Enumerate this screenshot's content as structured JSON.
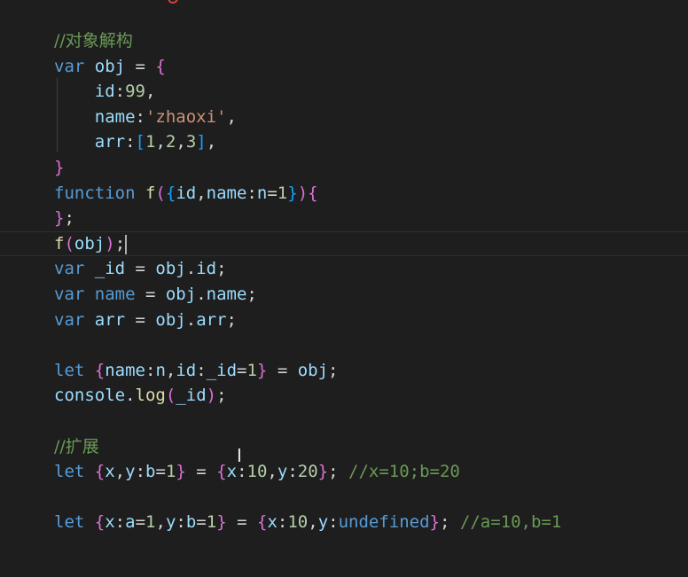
{
  "editor": {
    "colors": {
      "background": "#1e1e1e",
      "comment": "#6a9955",
      "keyword": "#569cd6",
      "identifier": "#9cdcfe",
      "function": "#dcdcaa",
      "string": "#ce9178",
      "number": "#b5cea8",
      "bracket_level1": "#da70d6",
      "bracket_level2": "#179fff",
      "bracket_level3": "#ffd700"
    },
    "current_line": 8,
    "lines": [
      {
        "tokens": [
          {
            "t": "//对象解构",
            "c": "tk-comment tk-cjk"
          }
        ]
      },
      {
        "tokens": [
          {
            "t": "var ",
            "c": "tk-keyword"
          },
          {
            "t": "obj",
            "c": "tk-ident"
          },
          {
            "t": " = ",
            "c": "tk-plain"
          },
          {
            "t": "{",
            "c": "tk-brace1"
          }
        ]
      },
      {
        "tokens": [
          {
            "t": "    ",
            "c": "tk-plain"
          },
          {
            "t": "id",
            "c": "tk-ident"
          },
          {
            "t": ":",
            "c": "tk-plain"
          },
          {
            "t": "99",
            "c": "tk-number"
          },
          {
            "t": ",",
            "c": "tk-plain"
          }
        ]
      },
      {
        "tokens": [
          {
            "t": "    ",
            "c": "tk-plain"
          },
          {
            "t": "name",
            "c": "tk-ident"
          },
          {
            "t": ":",
            "c": "tk-plain"
          },
          {
            "t": "'zhaoxi'",
            "c": "tk-string"
          },
          {
            "t": ",",
            "c": "tk-plain"
          }
        ]
      },
      {
        "tokens": [
          {
            "t": "    ",
            "c": "tk-plain"
          },
          {
            "t": "arr",
            "c": "tk-ident"
          },
          {
            "t": ":",
            "c": "tk-plain"
          },
          {
            "t": "[",
            "c": "tk-brace2"
          },
          {
            "t": "1",
            "c": "tk-number"
          },
          {
            "t": ",",
            "c": "tk-plain"
          },
          {
            "t": "2",
            "c": "tk-number"
          },
          {
            "t": ",",
            "c": "tk-plain"
          },
          {
            "t": "3",
            "c": "tk-number"
          },
          {
            "t": "]",
            "c": "tk-brace2"
          },
          {
            "t": ",",
            "c": "tk-plain"
          }
        ]
      },
      {
        "tokens": [
          {
            "t": "}",
            "c": "tk-brace1"
          }
        ]
      },
      {
        "tokens": [
          {
            "t": "function ",
            "c": "tk-keyword"
          },
          {
            "t": "f",
            "c": "tk-func"
          },
          {
            "t": "(",
            "c": "tk-brace1"
          },
          {
            "t": "{",
            "c": "tk-brace2"
          },
          {
            "t": "id",
            "c": "tk-ident"
          },
          {
            "t": ",",
            "c": "tk-plain"
          },
          {
            "t": "name",
            "c": "tk-ident"
          },
          {
            "t": ":",
            "c": "tk-plain"
          },
          {
            "t": "n",
            "c": "tk-ident"
          },
          {
            "t": "=",
            "c": "tk-plain"
          },
          {
            "t": "1",
            "c": "tk-number"
          },
          {
            "t": "}",
            "c": "tk-brace2"
          },
          {
            "t": ")",
            "c": "tk-brace1"
          },
          {
            "t": "{",
            "c": "tk-brace1"
          }
        ]
      },
      {
        "tokens": [
          {
            "t": "}",
            "c": "tk-brace1"
          },
          {
            "t": ";",
            "c": "tk-plain"
          }
        ]
      },
      {
        "tokens": [
          {
            "t": "f",
            "c": "tk-func"
          },
          {
            "t": "(",
            "c": "tk-brace1"
          },
          {
            "t": "obj",
            "c": "tk-ident"
          },
          {
            "t": ")",
            "c": "tk-brace1"
          },
          {
            "t": ";",
            "c": "tk-plain"
          }
        ]
      },
      {
        "tokens": [
          {
            "t": "var ",
            "c": "tk-keyword"
          },
          {
            "t": "_id",
            "c": "tk-ident"
          },
          {
            "t": " = ",
            "c": "tk-plain"
          },
          {
            "t": "obj",
            "c": "tk-ident"
          },
          {
            "t": ".",
            "c": "tk-plain"
          },
          {
            "t": "id",
            "c": "tk-ident"
          },
          {
            "t": ";",
            "c": "tk-plain"
          }
        ]
      },
      {
        "tokens": [
          {
            "t": "var ",
            "c": "tk-keyword"
          },
          {
            "t": "name",
            "c": "tk-keyword"
          },
          {
            "t": " = ",
            "c": "tk-plain"
          },
          {
            "t": "obj",
            "c": "tk-ident"
          },
          {
            "t": ".",
            "c": "tk-plain"
          },
          {
            "t": "name",
            "c": "tk-ident"
          },
          {
            "t": ";",
            "c": "tk-plain"
          }
        ]
      },
      {
        "tokens": [
          {
            "t": "var ",
            "c": "tk-keyword"
          },
          {
            "t": "arr",
            "c": "tk-ident"
          },
          {
            "t": " = ",
            "c": "tk-plain"
          },
          {
            "t": "obj",
            "c": "tk-ident"
          },
          {
            "t": ".",
            "c": "tk-plain"
          },
          {
            "t": "arr",
            "c": "tk-ident"
          },
          {
            "t": ";",
            "c": "tk-plain"
          }
        ]
      },
      {
        "tokens": []
      },
      {
        "tokens": [
          {
            "t": "let ",
            "c": "tk-keyword"
          },
          {
            "t": "{",
            "c": "tk-brace1"
          },
          {
            "t": "name",
            "c": "tk-ident"
          },
          {
            "t": ":",
            "c": "tk-plain"
          },
          {
            "t": "n",
            "c": "tk-ident"
          },
          {
            "t": ",",
            "c": "tk-plain"
          },
          {
            "t": "id",
            "c": "tk-ident"
          },
          {
            "t": ":",
            "c": "tk-plain"
          },
          {
            "t": "_id",
            "c": "tk-ident"
          },
          {
            "t": "=",
            "c": "tk-plain"
          },
          {
            "t": "1",
            "c": "tk-number"
          },
          {
            "t": "}",
            "c": "tk-brace1"
          },
          {
            "t": " = ",
            "c": "tk-plain"
          },
          {
            "t": "obj",
            "c": "tk-ident"
          },
          {
            "t": ";",
            "c": "tk-plain"
          }
        ]
      },
      {
        "tokens": [
          {
            "t": "console",
            "c": "tk-ident"
          },
          {
            "t": ".",
            "c": "tk-plain"
          },
          {
            "t": "log",
            "c": "tk-func"
          },
          {
            "t": "(",
            "c": "tk-brace1"
          },
          {
            "t": "_id",
            "c": "tk-ident"
          },
          {
            "t": ")",
            "c": "tk-brace1"
          },
          {
            "t": ";",
            "c": "tk-plain"
          }
        ]
      },
      {
        "tokens": []
      },
      {
        "tokens": [
          {
            "t": "//扩展",
            "c": "tk-comment tk-cjk"
          }
        ]
      },
      {
        "tokens": [
          {
            "t": "let ",
            "c": "tk-keyword"
          },
          {
            "t": "{",
            "c": "tk-brace1"
          },
          {
            "t": "x",
            "c": "tk-ident"
          },
          {
            "t": ",",
            "c": "tk-plain"
          },
          {
            "t": "y",
            "c": "tk-ident"
          },
          {
            "t": ":",
            "c": "tk-plain"
          },
          {
            "t": "b",
            "c": "tk-ident"
          },
          {
            "t": "=",
            "c": "tk-plain"
          },
          {
            "t": "1",
            "c": "tk-number"
          },
          {
            "t": "}",
            "c": "tk-brace1"
          },
          {
            "t": " = ",
            "c": "tk-plain"
          },
          {
            "t": "{",
            "c": "tk-brace1"
          },
          {
            "t": "x",
            "c": "tk-ident"
          },
          {
            "t": ":",
            "c": "tk-plain"
          },
          {
            "t": "10",
            "c": "tk-number"
          },
          {
            "t": ",",
            "c": "tk-plain"
          },
          {
            "t": "y",
            "c": "tk-ident"
          },
          {
            "t": ":",
            "c": "tk-plain"
          },
          {
            "t": "20",
            "c": "tk-number"
          },
          {
            "t": "}",
            "c": "tk-brace1"
          },
          {
            "t": "; ",
            "c": "tk-plain"
          },
          {
            "t": "//x=10;b=20",
            "c": "tk-comment"
          }
        ]
      },
      {
        "tokens": []
      },
      {
        "tokens": [
          {
            "t": "let ",
            "c": "tk-keyword"
          },
          {
            "t": "{",
            "c": "tk-brace1"
          },
          {
            "t": "x",
            "c": "tk-ident"
          },
          {
            "t": ":",
            "c": "tk-plain"
          },
          {
            "t": "a",
            "c": "tk-ident"
          },
          {
            "t": "=",
            "c": "tk-plain"
          },
          {
            "t": "1",
            "c": "tk-number"
          },
          {
            "t": ",",
            "c": "tk-plain"
          },
          {
            "t": "y",
            "c": "tk-ident"
          },
          {
            "t": ":",
            "c": "tk-plain"
          },
          {
            "t": "b",
            "c": "tk-ident"
          },
          {
            "t": "=",
            "c": "tk-plain"
          },
          {
            "t": "1",
            "c": "tk-number"
          },
          {
            "t": "}",
            "c": "tk-brace1"
          },
          {
            "t": " = ",
            "c": "tk-plain"
          },
          {
            "t": "{",
            "c": "tk-brace1"
          },
          {
            "t": "x",
            "c": "tk-ident"
          },
          {
            "t": ":",
            "c": "tk-plain"
          },
          {
            "t": "10",
            "c": "tk-number"
          },
          {
            "t": ",",
            "c": "tk-plain"
          },
          {
            "t": "y",
            "c": "tk-ident"
          },
          {
            "t": ":",
            "c": "tk-plain"
          },
          {
            "t": "undefined",
            "c": "tk-undef"
          },
          {
            "t": "}",
            "c": "tk-brace1"
          },
          {
            "t": "; ",
            "c": "tk-plain"
          },
          {
            "t": "//a=10,b=1",
            "c": "tk-comment"
          }
        ]
      }
    ]
  }
}
